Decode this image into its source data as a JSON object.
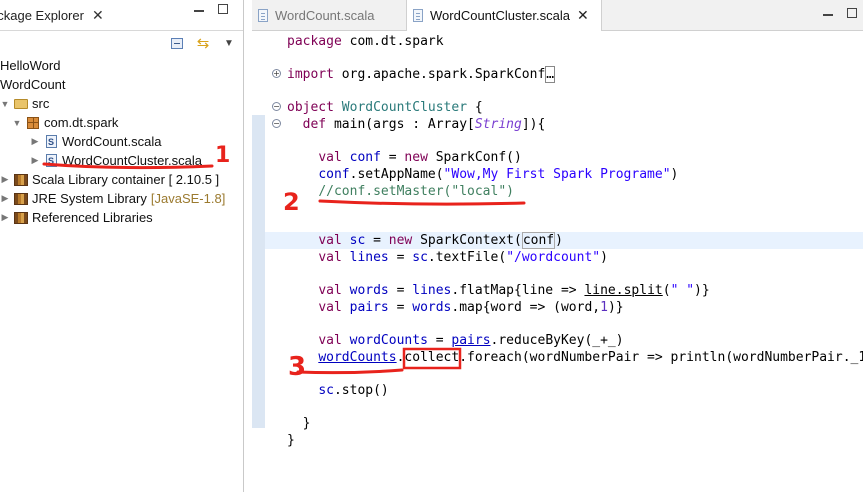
{
  "explorer": {
    "tab_label": "ackage Explorer",
    "tree": [
      {
        "label": "HelloWord"
      },
      {
        "label": "WordCount"
      },
      {
        "label": "src"
      },
      {
        "label": "com.dt.spark"
      },
      {
        "label": "WordCount.scala"
      },
      {
        "label": "WordCountCluster.scala"
      },
      {
        "label": "Scala Library container [ 2.10.5 ]"
      },
      {
        "label": "JRE System Library",
        "detail": "[JavaSE-1.8]"
      },
      {
        "label": "Referenced Libraries"
      }
    ]
  },
  "editor": {
    "tabs": [
      {
        "label": "WordCount.scala",
        "active": false
      },
      {
        "label": "WordCountCluster.scala",
        "active": true
      }
    ]
  },
  "annotations": [
    "1",
    "2",
    "3"
  ],
  "colors": {
    "annotation": "#e8231c",
    "keyword": "#7f0055",
    "string": "#2a00ff",
    "comment": "#3f7f5f",
    "field": "#0000c0",
    "highlight": "#e8f2fe"
  }
}
